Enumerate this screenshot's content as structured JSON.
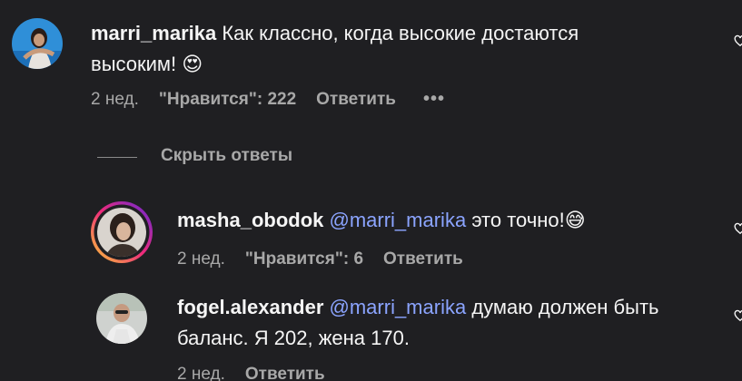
{
  "thread": {
    "hide_replies_label": "Скрыть ответы",
    "more_label": "•••",
    "comments": [
      {
        "username": "marri_marika",
        "text": "Как классно, когда высокие достаются высоким!",
        "emoji": "😍",
        "time": "2 нед.",
        "likes": "\"Нравится\": 222",
        "reply_label": "Ответить"
      }
    ],
    "replies": [
      {
        "username": "masha_obodok",
        "mention": "@marri_marika",
        "text": "это точно!",
        "emoji": "😅",
        "time": "2 нед.",
        "likes": "\"Нравится\": 6",
        "reply_label": "Ответить"
      },
      {
        "username": "fogel.alexander",
        "mention": "@marri_marika",
        "text": "думаю должен быть баланс. Я 202, жена 170.",
        "time": "2 нед.",
        "reply_label": "Ответить"
      }
    ]
  },
  "colors": {
    "background": "#1f1f22",
    "mention": "#8ba4ff",
    "meta": "#a8a8a8",
    "story_ring_start": "#f9ce34",
    "story_ring_mid": "#ee2a7b",
    "story_ring_end": "#6228d7"
  },
  "icons": {
    "heart": "heart-icon",
    "more": "more-options-icon"
  }
}
